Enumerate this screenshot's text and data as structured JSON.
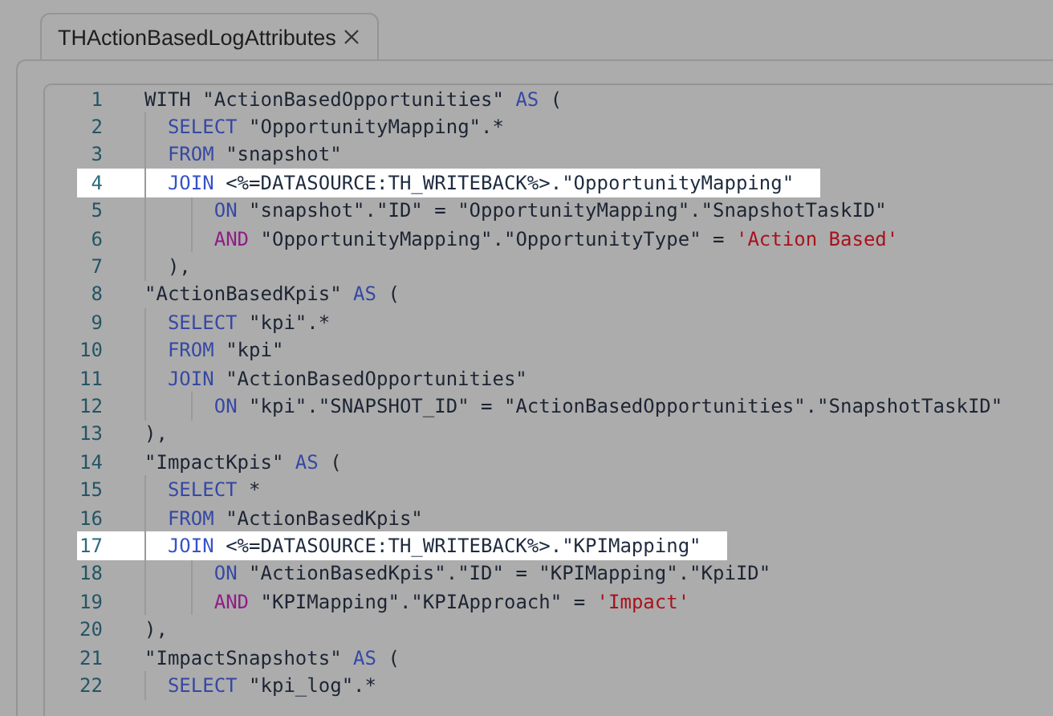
{
  "tab": {
    "title": "THActionBasedLogAttributes",
    "selected": true
  },
  "editor": {
    "lines": [
      {
        "number": "1",
        "highlighted": false,
        "tokens": [
          {
            "kind": "text",
            "text": "WITH \"ActionBasedOpportunities\" "
          },
          {
            "kind": "keyword",
            "text": "AS"
          },
          {
            "kind": "text",
            "text": " ("
          }
        ],
        "children": [
          {
            "number": "2",
            "highlighted": false,
            "tokens": [
              {
                "kind": "keyword",
                "text": "SELECT"
              },
              {
                "kind": "text",
                "text": " \"OpportunityMapping\".*"
              }
            ]
          },
          {
            "number": "3",
            "highlighted": false,
            "tokens": [
              {
                "kind": "keyword",
                "text": "FROM"
              },
              {
                "kind": "text",
                "text": " \"snapshot\""
              }
            ]
          },
          {
            "number": "4",
            "highlighted": true,
            "tokens": [
              {
                "kind": "keyword",
                "text": "JOIN"
              },
              {
                "kind": "text",
                "text": " <%=DATASOURCE:TH_WRITEBACK%>.\"OpportunityMapping\""
              }
            ],
            "children": [
              {
                "number": "5",
                "highlighted": false,
                "tokens": [
                  {
                    "kind": "keyword",
                    "text": "ON"
                  },
                  {
                    "kind": "text",
                    "text": " \"snapshot\".\"ID\" = \"OpportunityMapping\".\"SnapshotTaskID\""
                  }
                ]
              },
              {
                "number": "6",
                "highlighted": false,
                "tokens": [
                  {
                    "kind": "operator",
                    "text": "AND"
                  },
                  {
                    "kind": "text",
                    "text": " \"OpportunityMapping\".\"OpportunityType\" = "
                  },
                  {
                    "kind": "string",
                    "text": "'Action Based'"
                  }
                ]
              }
            ]
          },
          {
            "number": "7",
            "highlighted": false,
            "tokens": [
              {
                "kind": "text",
                "text": "),"
              }
            ]
          }
        ]
      },
      {
        "number": "8",
        "highlighted": false,
        "tokens": [
          {
            "kind": "text",
            "text": "\"ActionBasedKpis\" "
          },
          {
            "kind": "keyword",
            "text": "AS"
          },
          {
            "kind": "text",
            "text": " ("
          }
        ],
        "children": [
          {
            "number": "9",
            "highlighted": false,
            "tokens": [
              {
                "kind": "keyword",
                "text": "SELECT"
              },
              {
                "kind": "text",
                "text": " \"kpi\".*"
              }
            ]
          },
          {
            "number": "10",
            "highlighted": false,
            "tokens": [
              {
                "kind": "keyword",
                "text": "FROM"
              },
              {
                "kind": "text",
                "text": " \"kpi\""
              }
            ]
          },
          {
            "number": "11",
            "highlighted": false,
            "tokens": [
              {
                "kind": "keyword",
                "text": "JOIN"
              },
              {
                "kind": "text",
                "text": " \"ActionBasedOpportunities\""
              }
            ],
            "children": [
              {
                "number": "12",
                "highlighted": false,
                "tokens": [
                  {
                    "kind": "keyword",
                    "text": "ON"
                  },
                  {
                    "kind": "text",
                    "text": " \"kpi\".\"SNAPSHOT_ID\" = \"ActionBasedOpportunities\".\"SnapshotTaskID\""
                  }
                ]
              }
            ]
          }
        ]
      },
      {
        "number": "13",
        "highlighted": false,
        "tokens": [
          {
            "kind": "text",
            "text": "),"
          }
        ]
      },
      {
        "number": "14",
        "highlighted": false,
        "tokens": [
          {
            "kind": "text",
            "text": "\"ImpactKpis\" "
          },
          {
            "kind": "keyword",
            "text": "AS"
          },
          {
            "kind": "text",
            "text": " ("
          }
        ],
        "children": [
          {
            "number": "15",
            "highlighted": false,
            "tokens": [
              {
                "kind": "keyword",
                "text": "SELECT"
              },
              {
                "kind": "text",
                "text": " *"
              }
            ]
          },
          {
            "number": "16",
            "highlighted": false,
            "tokens": [
              {
                "kind": "keyword",
                "text": "FROM"
              },
              {
                "kind": "text",
                "text": " \"ActionBasedKpis\""
              }
            ]
          },
          {
            "number": "17",
            "highlighted": true,
            "tokens": [
              {
                "kind": "keyword",
                "text": "JOIN"
              },
              {
                "kind": "text",
                "text": " <%=DATASOURCE:TH_WRITEBACK%>.\"KPIMapping\""
              }
            ],
            "children": [
              {
                "number": "18",
                "highlighted": false,
                "tokens": [
                  {
                    "kind": "keyword",
                    "text": "ON"
                  },
                  {
                    "kind": "text",
                    "text": " \"ActionBasedKpis\".\"ID\" = \"KPIMapping\".\"KpiID\""
                  }
                ]
              },
              {
                "number": "19",
                "highlighted": false,
                "tokens": [
                  {
                    "kind": "operator",
                    "text": "AND"
                  },
                  {
                    "kind": "text",
                    "text": " \"KPIMapping\".\"KPIApproach\" = "
                  },
                  {
                    "kind": "string",
                    "text": "'Impact'"
                  }
                ]
              }
            ]
          }
        ]
      },
      {
        "number": "20",
        "highlighted": false,
        "tokens": [
          {
            "kind": "text",
            "text": "),"
          }
        ]
      },
      {
        "number": "21",
        "highlighted": false,
        "tokens": [
          {
            "kind": "text",
            "text": "\"ImpactSnapshots\" "
          },
          {
            "kind": "keyword",
            "text": "AS"
          },
          {
            "kind": "text",
            "text": " ("
          }
        ],
        "children": [
          {
            "number": "22",
            "highlighted": false,
            "tokens": [
              {
                "kind": "keyword",
                "text": "SELECT"
              },
              {
                "kind": "text",
                "text": " \"kpi_log\".*"
              }
            ]
          }
        ]
      }
    ]
  }
}
